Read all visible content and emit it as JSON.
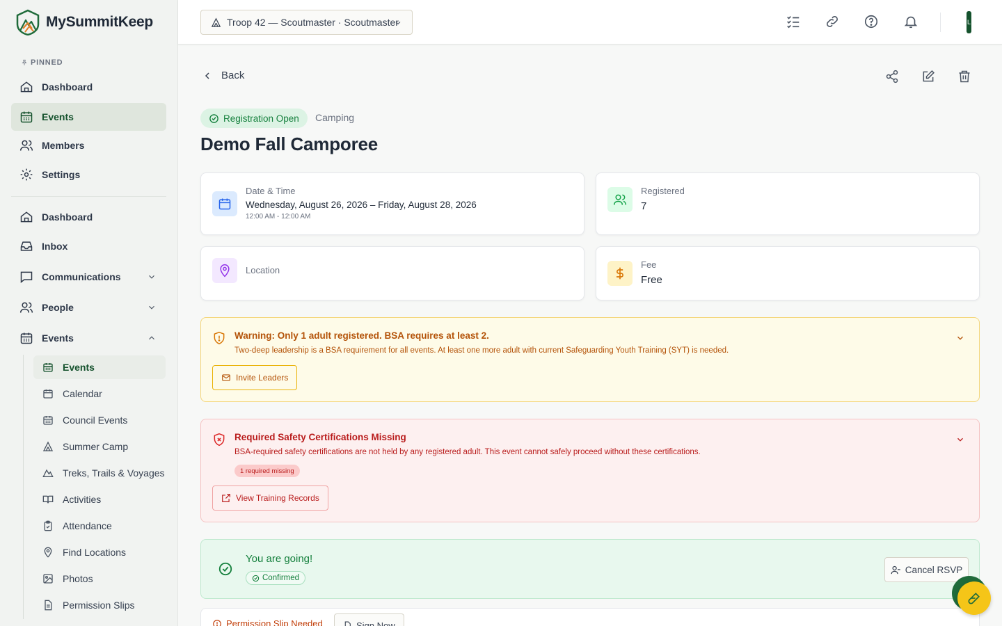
{
  "app": {
    "name": "MySummitKeep"
  },
  "sidebar": {
    "pinned_label": "PINNED",
    "pinned": [
      {
        "label": "Dashboard",
        "icon": "home-icon"
      },
      {
        "label": "Events",
        "icon": "calendar-icon"
      },
      {
        "label": "Members",
        "icon": "users-icon"
      },
      {
        "label": "Settings",
        "icon": "gear-icon"
      }
    ],
    "nav": [
      {
        "label": "Dashboard",
        "icon": "home-icon"
      },
      {
        "label": "Inbox",
        "icon": "inbox-icon"
      },
      {
        "label": "Communications",
        "icon": "chat-icon",
        "expanded": false
      },
      {
        "label": "People",
        "icon": "users-icon",
        "expanded": false
      },
      {
        "label": "Events",
        "icon": "calendar-icon",
        "expanded": true
      }
    ],
    "sub": [
      {
        "label": "Events",
        "icon": "calendar-grid-icon"
      },
      {
        "label": "Calendar",
        "icon": "calendar-icon"
      },
      {
        "label": "Council Events",
        "icon": "calendar-grid-icon"
      },
      {
        "label": "Summer Camp",
        "icon": "tent-icon"
      },
      {
        "label": "Treks, Trails & Voyages",
        "icon": "mountain-icon"
      },
      {
        "label": "Activities",
        "icon": "book-icon"
      },
      {
        "label": "Attendance",
        "icon": "clipboard-icon"
      },
      {
        "label": "Find Locations",
        "icon": "map-pin-icon"
      },
      {
        "label": "Photos",
        "icon": "image-icon"
      },
      {
        "label": "Permission Slips",
        "icon": "document-icon"
      }
    ]
  },
  "topbar": {
    "troop_label": "Troop 42 — Scoutmaster · Scoutmaster",
    "avatar_initial": "L"
  },
  "event": {
    "back_label": "Back",
    "status": "Registration Open",
    "category": "Camping",
    "title": "Demo Fall Camporee",
    "date_label": "Date & Time",
    "date_value": "Wednesday, August 26, 2026 – Friday, August 28, 2026",
    "time_value": "12:00 AM - 12:00 AM",
    "registered_label": "Registered",
    "registered_value": "7",
    "location_label": "Location",
    "fee_label": "Fee",
    "fee_value": "Free"
  },
  "warning": {
    "title": "Warning: Only 1 adult registered. BSA requires at least 2.",
    "text": "Two-deep leadership is a BSA requirement for all events. At least one more adult with current Safeguarding Youth Training (SYT) is needed.",
    "button": "Invite Leaders"
  },
  "safety": {
    "title": "Required Safety Certifications Missing",
    "text": "BSA-required safety certifications are not held by any registered adult. This event cannot safely proceed without these certifications.",
    "badge": "1 required missing",
    "button": "View Training Records"
  },
  "rsvp": {
    "title": "You are going!",
    "badge": "Confirmed",
    "cancel_button": "Cancel RSVP"
  },
  "permission": {
    "label": "Permission Slip Needed",
    "button": "Sign Now"
  },
  "colors": {
    "brand_green": "#15522d",
    "success": "#15803d",
    "warning": "#b45309",
    "danger": "#b91c1c",
    "accent_yellow": "#f5c518"
  }
}
